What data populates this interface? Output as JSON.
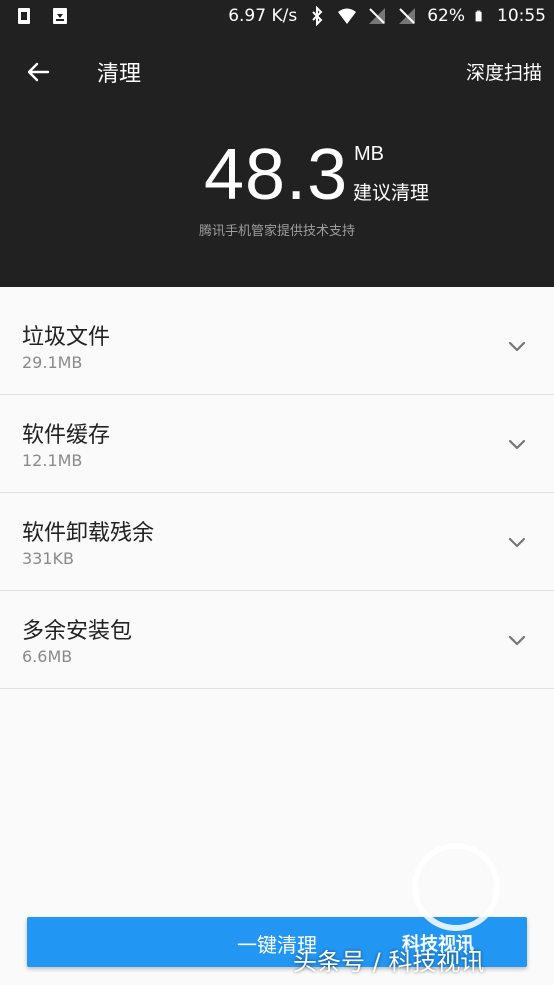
{
  "status_bar": {
    "net_speed": "6.97 K/s",
    "battery": "62%",
    "time": "10:55"
  },
  "app_bar": {
    "title": "清理",
    "deep_scan": "深度扫描"
  },
  "summary": {
    "size": "48.3",
    "unit": "MB",
    "suggest": "建议清理",
    "provider": "腾讯手机管家提供技术支持"
  },
  "categories": [
    {
      "title": "垃圾文件",
      "size": "29.1MB"
    },
    {
      "title": "软件缓存",
      "size": "12.1MB"
    },
    {
      "title": "软件卸载残余",
      "size": "331KB"
    },
    {
      "title": "多余安装包",
      "size": "6.6MB"
    }
  ],
  "action": {
    "label": "一键清理"
  },
  "watermark": {
    "main": "头条号 / 科技视讯",
    "sub": "科技视讯"
  },
  "colors": {
    "header_bg": "#212121",
    "accent": "#2196f3"
  }
}
